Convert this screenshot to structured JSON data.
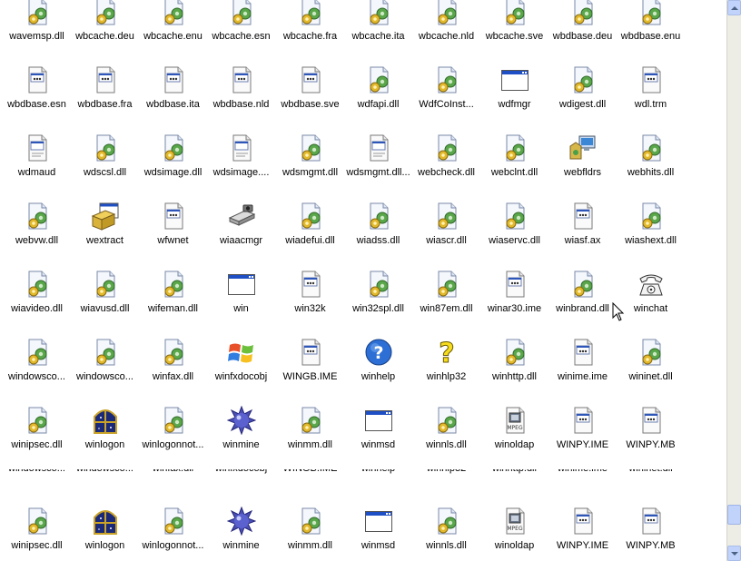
{
  "rows": [
    {
      "items": [
        {
          "label": "wavemsp.dll",
          "icon": "dll-gear-icon"
        },
        {
          "label": "wbcache.deu",
          "icon": "dll-gear-icon"
        },
        {
          "label": "wbcache.enu",
          "icon": "dll-gear-icon"
        },
        {
          "label": "wbcache.esn",
          "icon": "dll-gear-icon"
        },
        {
          "label": "wbcache.fra",
          "icon": "dll-gear-icon"
        },
        {
          "label": "wbcache.ita",
          "icon": "dll-gear-icon"
        },
        {
          "label": "wbcache.nld",
          "icon": "dll-gear-icon"
        },
        {
          "label": "wbcache.sve",
          "icon": "dll-gear-icon"
        },
        {
          "label": "wbdbase.deu",
          "icon": "dll-gear-icon"
        },
        {
          "label": "wbdbase.enu",
          "icon": "dll-gear-icon"
        }
      ]
    },
    {
      "items": [
        {
          "label": "wbdbase.esn",
          "icon": "generic-file-icon"
        },
        {
          "label": "wbdbase.fra",
          "icon": "generic-file-icon"
        },
        {
          "label": "wbdbase.ita",
          "icon": "generic-file-icon"
        },
        {
          "label": "wbdbase.nld",
          "icon": "generic-file-icon"
        },
        {
          "label": "wbdbase.sve",
          "icon": "generic-file-icon"
        },
        {
          "label": "wdfapi.dll",
          "icon": "dll-gear-icon"
        },
        {
          "label": "WdfCoInst...",
          "icon": "dll-gear-icon"
        },
        {
          "label": "wdfmgr",
          "icon": "application-window-icon"
        },
        {
          "label": "wdigest.dll",
          "icon": "dll-gear-icon"
        },
        {
          "label": "wdl.trm",
          "icon": "generic-file-icon"
        }
      ]
    },
    {
      "items": [
        {
          "label": "wdmaud",
          "icon": "text-file-icon"
        },
        {
          "label": "wdscsl.dll",
          "icon": "dll-gear-icon"
        },
        {
          "label": "wdsimage.dll",
          "icon": "dll-gear-icon"
        },
        {
          "label": "wdsimage....",
          "icon": "text-file-icon"
        },
        {
          "label": "wdsmgmt.dll",
          "icon": "dll-gear-icon"
        },
        {
          "label": "wdsmgmt.dll...",
          "icon": "text-file-icon"
        },
        {
          "label": "webcheck.dll",
          "icon": "dll-gear-icon"
        },
        {
          "label": "webclnt.dll",
          "icon": "dll-gear-icon"
        },
        {
          "label": "webfldrs",
          "icon": "webfolders-icon"
        },
        {
          "label": "webhits.dll",
          "icon": "dll-gear-icon"
        }
      ]
    },
    {
      "items": [
        {
          "label": "webvw.dll",
          "icon": "dll-gear-icon"
        },
        {
          "label": "wextract",
          "icon": "installer-box-icon"
        },
        {
          "label": "wfwnet",
          "icon": "generic-file-icon"
        },
        {
          "label": "wiaacmgr",
          "icon": "scanner-camera-icon"
        },
        {
          "label": "wiadefui.dll",
          "icon": "dll-gear-icon"
        },
        {
          "label": "wiadss.dll",
          "icon": "dll-gear-icon"
        },
        {
          "label": "wiascr.dll",
          "icon": "dll-gear-icon"
        },
        {
          "label": "wiaservc.dll",
          "icon": "dll-gear-icon"
        },
        {
          "label": "wiasf.ax",
          "icon": "generic-file-icon"
        },
        {
          "label": "wiashext.dll",
          "icon": "dll-gear-icon"
        }
      ]
    },
    {
      "items": [
        {
          "label": "wiavideo.dll",
          "icon": "dll-gear-icon"
        },
        {
          "label": "wiavusd.dll",
          "icon": "dll-gear-icon"
        },
        {
          "label": "wifeman.dll",
          "icon": "dll-gear-icon"
        },
        {
          "label": "win",
          "icon": "application-window-icon"
        },
        {
          "label": "win32k",
          "icon": "generic-file-icon"
        },
        {
          "label": "win32spl.dll",
          "icon": "dll-gear-icon"
        },
        {
          "label": "win87em.dll",
          "icon": "dll-gear-icon"
        },
        {
          "label": "winar30.ime",
          "icon": "generic-file-icon"
        },
        {
          "label": "winbrand.dll",
          "icon": "dll-gear-icon"
        },
        {
          "label": "winchat",
          "icon": "telephone-icon"
        }
      ]
    },
    {
      "items": [
        {
          "label": "windowsco...",
          "icon": "dll-gear-icon"
        },
        {
          "label": "windowsco...",
          "icon": "dll-gear-icon"
        },
        {
          "label": "winfax.dll",
          "icon": "dll-gear-icon"
        },
        {
          "label": "winfxdocobj",
          "icon": "windows-flag-icon"
        },
        {
          "label": "WINGB.IME",
          "icon": "generic-file-icon"
        },
        {
          "label": "winhelp",
          "icon": "help-question-icon"
        },
        {
          "label": "winhlp32",
          "icon": "help-yellow-question-icon"
        },
        {
          "label": "winhttp.dll",
          "icon": "dll-gear-icon"
        },
        {
          "label": "winime.ime",
          "icon": "generic-file-icon"
        },
        {
          "label": "wininet.dll",
          "icon": "dll-gear-icon"
        }
      ]
    },
    {
      "items": [
        {
          "label": "winipsec.dll",
          "icon": "dll-gear-icon"
        },
        {
          "label": "winlogon",
          "icon": "winlogon-window-icon"
        },
        {
          "label": "winlogonnot...",
          "icon": "dll-gear-icon"
        },
        {
          "label": "winmine",
          "icon": "mine-icon"
        },
        {
          "label": "winmm.dll",
          "icon": "dll-gear-icon"
        },
        {
          "label": "winmsd",
          "icon": "application-window-icon"
        },
        {
          "label": "winnls.dll",
          "icon": "dll-gear-icon"
        },
        {
          "label": "winoldap",
          "icon": "mpeg-file-icon"
        },
        {
          "label": "WINPY.IME",
          "icon": "generic-file-icon"
        },
        {
          "label": "WINPY.MB",
          "icon": "generic-file-icon"
        }
      ]
    },
    {
      "items": [
        {
          "label": "winipsec.dll",
          "icon": "dll-gear-icon"
        },
        {
          "label": "winlogon",
          "icon": "winlogon-window-icon"
        },
        {
          "label": "winlogonnot...",
          "icon": "dll-gear-icon"
        },
        {
          "label": "winmine",
          "icon": "mine-icon"
        },
        {
          "label": "winmm.dll",
          "icon": "dll-gear-icon"
        },
        {
          "label": "winmsd",
          "icon": "application-window-icon"
        },
        {
          "label": "winnls.dll",
          "icon": "dll-gear-icon"
        },
        {
          "label": "winoldap",
          "icon": "mpeg-file-icon"
        },
        {
          "label": "WINPY.IME",
          "icon": "generic-file-icon"
        },
        {
          "label": "WINPY.MB",
          "icon": "generic-file-icon"
        }
      ]
    }
  ],
  "scrollbar": {
    "up_icon": "scroll-up-arrow-icon",
    "down_icon": "scroll-down-arrow-icon"
  },
  "colors": {
    "background": "#ffffff",
    "text": "#000000",
    "scroll_track": "#eeede5",
    "scroll_button": "#c1d3fb"
  }
}
